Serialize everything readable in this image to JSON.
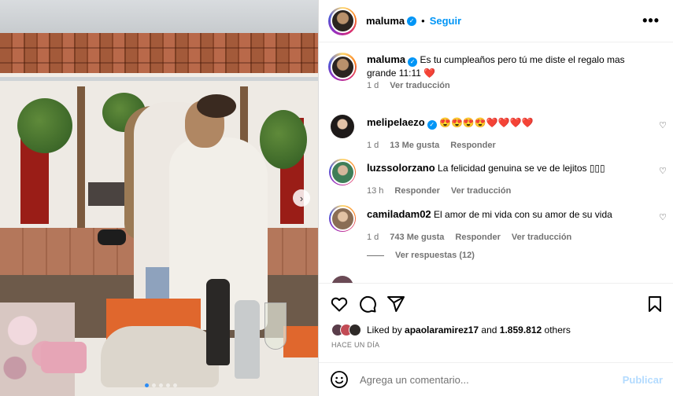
{
  "post": {
    "username": "maluma",
    "follow_label": "Seguir",
    "separator": "•",
    "more_label": "•••",
    "caption": "Es tu cumpleaños pero tú me diste el regalo mas grande 11:11 ❤️",
    "caption_time": "1 d",
    "caption_translate": "Ver traducción",
    "carousel_next": "›"
  },
  "comments": [
    {
      "username": "melipelaezo",
      "verified": true,
      "text": "😍😍😍😍❤️❤️❤️❤️",
      "time": "1 d",
      "likes": "13 Me gusta",
      "reply": "Responder"
    },
    {
      "username": "luzssolorzano",
      "text": "La felicidad genuina se ve de lejitos ▯▯▯",
      "time": "13 h",
      "reply": "Responder",
      "translate": "Ver traducción"
    },
    {
      "username": "camiladam02",
      "text": "El amor de mi vida con su amor de su vida",
      "time": "1 d",
      "likes": "743 Me gusta",
      "reply": "Responder",
      "translate": "Ver traducción"
    }
  ],
  "view_replies": "Ver respuestas (12)",
  "likes": {
    "prefix": "Liked by ",
    "user": "apaolaramirez17",
    "mid": " and ",
    "count": "1.859.812",
    "suffix": " others"
  },
  "posted_ago": "HACE UN DÍA",
  "add_comment": {
    "placeholder": "Agrega un comentario...",
    "publish_label": "Publicar"
  },
  "icons": {
    "like": "heart-outline-icon",
    "comment": "speech-bubble-icon",
    "share": "paper-plane-icon",
    "save": "bookmark-icon",
    "emoji": "smiley-icon"
  },
  "colors": {
    "accent": "#0095f6",
    "publish_disabled": "#b3dbff",
    "secondary_text": "#737373"
  }
}
